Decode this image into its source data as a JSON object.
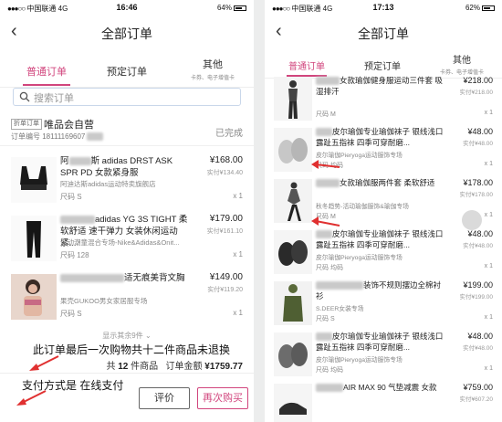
{
  "colors": {
    "accent": "#d1457d",
    "annotation_arrow": "#e03030"
  },
  "left": {
    "status": {
      "carrier": "中国联通",
      "network": "4G",
      "time": "16:46",
      "battery": "64%"
    },
    "title": "全部订单",
    "tabs": [
      {
        "label": "普通订单",
        "active": true
      },
      {
        "label": "预定订单",
        "active": false
      },
      {
        "label": "其他",
        "sub": "卡券、电子增值卡",
        "active": false
      }
    ],
    "search_placeholder": "搜索订单",
    "store": {
      "badge": "折单订单",
      "name": "唯品会自营",
      "order_no": "订单编号 18111169607",
      "state": "已完成"
    },
    "items": [
      {
        "title_pre": "阿",
        "title": "斯 adidas DRST ASK SPR PD 女款紧身服",
        "shop": "阿迪达斯adidas运动特卖旗舰店",
        "size": "尺码 S",
        "price": "¥168.00",
        "subprice": "实付¥134.40",
        "qty": "x 1"
      },
      {
        "title_pre": "",
        "title": "adidas YG 3S TIGHT 柔软舒适 速干弹力 女装休闲运动紧...",
        "shop": "运动潮童混合专场-Nike&Adidas&Onit...",
        "size": "尺码 128",
        "price": "¥179.00",
        "subprice": "实付¥161.10",
        "qty": "x 1"
      },
      {
        "title_pre": "",
        "title": "适无痕美背文胸",
        "shop": "果壳GUKOO男女家居服专场",
        "size": "尺码 S",
        "price": "¥149.00",
        "subprice": "实付¥119.20",
        "qty": "x 1"
      }
    ],
    "more_text": "显示其余9件",
    "annotation_1": "此订单最后一次购物共十二件商品未退换",
    "total": {
      "prefix": "共",
      "count": "12",
      "suffix": "件商品",
      "label": "订单金额",
      "amount": "¥1759.77"
    },
    "annotation_2": "支付方式是   在线支付",
    "buttons": {
      "evaluate": "评价",
      "rebuy": "再次购买"
    }
  },
  "right": {
    "status": {
      "carrier": "中国联通",
      "network": "4G",
      "time": "17:13",
      "battery": "62%"
    },
    "title": "全部订单",
    "tabs": [
      {
        "label": "普通订单",
        "active": true
      },
      {
        "label": "预定订单",
        "active": false
      },
      {
        "label": "其他",
        "sub": "卡券、电子增值卡",
        "active": false
      }
    ],
    "items": [
      {
        "title": "女款瑜伽健身服运动三件套 吸湿排汗",
        "shop": "",
        "size": "尺码 M",
        "price": "¥218.00",
        "subprice": "实付¥218.00",
        "qty": "x 1",
        "partial": true
      },
      {
        "title": "皮尔瑜伽专业瑜伽袜子 银线浅口露趾五指袜 四季可穿耐磨...",
        "shop": "皮尔瑜伽Pieryoga运动服饰专场",
        "size": "尺码 均码",
        "price": "¥48.00",
        "subprice": "实付¥48.00",
        "qty": "x 1"
      },
      {
        "title": "女款瑜伽服两件套 柔软舒适",
        "shop": "秋冬趋势-活动瑜伽服饰&瑜伽专场",
        "size": "尺码 M",
        "price": "¥178.00",
        "subprice": "实付¥178.00",
        "qty": "x 1"
      },
      {
        "title": "皮尔瑜伽专业瑜伽袜子 银线浅口露趾五指袜 四季可穿耐磨...",
        "shop": "皮尔瑜伽Pieryoga运动服饰专场",
        "size": "尺码 均码",
        "price": "¥48.00",
        "subprice": "实付¥48.00",
        "qty": "x 1"
      },
      {
        "title": "装饰不规则摆边全棉衬衫",
        "shop": "S.DEER女装专场",
        "size": "尺码 S",
        "price": "¥199.00",
        "subprice": "实付¥199.00",
        "qty": "x 1"
      },
      {
        "title": "皮尔瑜伽专业瑜伽袜子 银线浅口露趾五指袜 四季可穿耐磨...",
        "shop": "皮尔瑜伽Pieryoga运动服饰专场",
        "size": "尺码 均码",
        "price": "¥48.00",
        "subprice": "实付¥48.00",
        "qty": "x 1"
      },
      {
        "title": "AIR MAX 90 气垫减震 女款",
        "shop": "",
        "size": "",
        "price": "¥759.00",
        "subprice": "实付¥607.20",
        "qty": "",
        "partial": true
      }
    ]
  }
}
